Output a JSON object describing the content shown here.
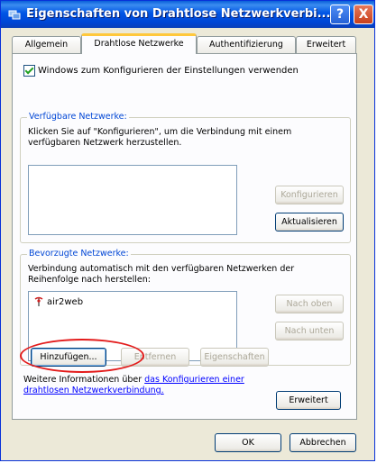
{
  "window": {
    "title": "Eigenschaften von Drahtlose Netzwerkverbi...",
    "help_label": "?",
    "close_label": "X"
  },
  "tabs": [
    {
      "label": "Allgemein"
    },
    {
      "label": "Drahtlose Netzwerke"
    },
    {
      "label": "Authentifizierung"
    },
    {
      "label": "Erweitert"
    }
  ],
  "use_windows_checkbox": {
    "label": "Windows zum Konfigurieren der Einstellungen verwenden",
    "checked": true
  },
  "available_networks": {
    "title": "Verfügbare Netzwerke:",
    "description": "Klicken Sie auf \"Konfigurieren\", um die Verbindung mit einem verfügbaren Netzwerk herzustellen.",
    "configure_label": "Konfigurieren",
    "refresh_label": "Aktualisieren"
  },
  "preferred_networks": {
    "title": "Bevorzugte Netzwerke:",
    "description": "Verbindung automatisch mit den verfügbaren Netzwerken der Reihenfolge nach herstellen:",
    "items": [
      "air2web"
    ],
    "up_label": "Nach oben",
    "down_label": "Nach unten",
    "add_label": "Hinzufügen...",
    "remove_label": "Entfernen",
    "properties_label": "Eigenschaften"
  },
  "more_info": {
    "prefix": "Weitere Informationen über ",
    "link": "das Konfigurieren einer drahtlosen Netzwerkverbindung."
  },
  "advanced_label": "Erweitert",
  "footer": {
    "ok_label": "OK",
    "cancel_label": "Abbrechen"
  },
  "colors": {
    "titlebar": "#0055e5",
    "group_title": "#0046d5",
    "highlight_oval": "#e31b1b"
  }
}
